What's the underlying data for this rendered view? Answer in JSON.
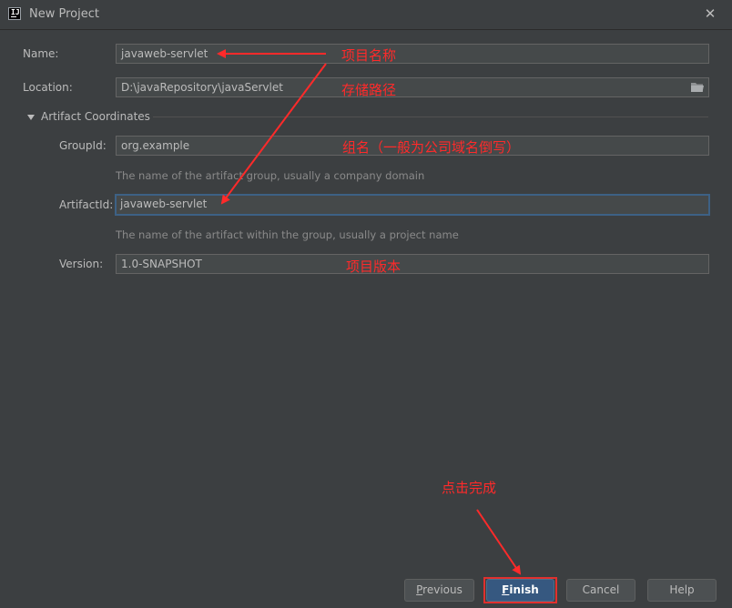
{
  "window": {
    "title": "New Project"
  },
  "form": {
    "name_label": "Name:",
    "name_value": "javaweb-servlet",
    "location_label": "Location:",
    "location_value": "D:\\javaRepository\\javaServlet",
    "section_title": "Artifact Coordinates",
    "groupid_label": "GroupId:",
    "groupid_value": "org.example",
    "groupid_hint": "The name of the artifact group, usually a company domain",
    "artifactid_label": "ArtifactId:",
    "artifactid_value": "javaweb-servlet",
    "artifactid_hint": "The name of the artifact within the group, usually a project name",
    "version_label": "Version:",
    "version_value": "1.0-SNAPSHOT"
  },
  "annotations": {
    "name": "项目名称",
    "location": "存储路径",
    "groupid": "组名（一般为公司域名倒写）",
    "version": "项目版本",
    "finish": "点击完成"
  },
  "buttons": {
    "previous_first": "P",
    "previous_rest": "revious",
    "finish_first": "F",
    "finish_rest": "inish",
    "cancel": "Cancel",
    "help": "Help"
  },
  "colors": {
    "background": "#3c3f41",
    "field_bg": "#45494a",
    "annotation": "#ff2a2a",
    "primary_button": "#365880"
  },
  "icons": [
    "intellij-app-icon",
    "close-icon",
    "folder-icon",
    "collapse-triangle-icon"
  ]
}
